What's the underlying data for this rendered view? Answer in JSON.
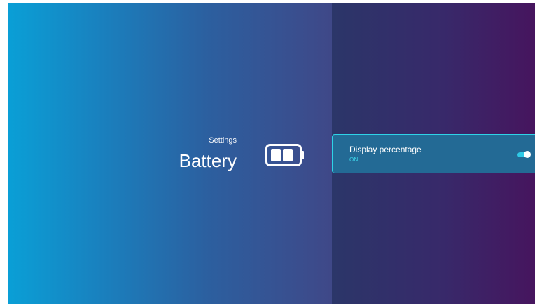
{
  "breadcrumb": "Settings",
  "page_title": "Battery",
  "icons": {
    "battery": "battery-icon",
    "toggle": "toggle-switch"
  },
  "setting": {
    "label": "Display percentage",
    "value": "ON",
    "enabled": true
  },
  "colors": {
    "accent": "#2ed3e8",
    "left_gradient_start": "#0a9fd6",
    "left_gradient_end": "#3f4888",
    "right_gradient_start": "#2b3669",
    "right_gradient_end": "#46155e",
    "selected_row": "#236a95"
  }
}
